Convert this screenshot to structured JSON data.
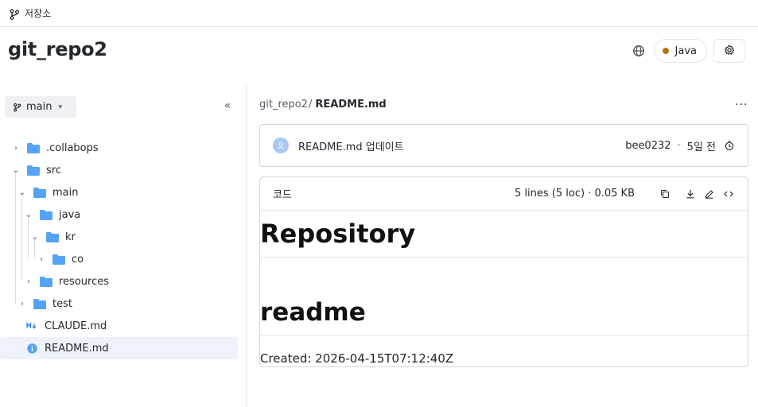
{
  "topbar": {
    "label": "저장소"
  },
  "repo": {
    "title": "git_repo2",
    "language": "Java",
    "language_color": "#b07219"
  },
  "sidebar": {
    "branch": "main",
    "collapse_glyph": "«",
    "tree": [
      {
        "name": ".collabops",
        "type": "folder",
        "expanded": false
      },
      {
        "name": "src",
        "type": "folder",
        "expanded": true
      },
      {
        "name": "main",
        "type": "folder",
        "expanded": true
      },
      {
        "name": "java",
        "type": "folder",
        "expanded": true
      },
      {
        "name": "kr",
        "type": "folder",
        "expanded": true
      },
      {
        "name": "co",
        "type": "folder",
        "expanded": false
      },
      {
        "name": "resources",
        "type": "folder",
        "expanded": false
      },
      {
        "name": "test",
        "type": "folder",
        "expanded": false
      },
      {
        "name": "CLAUDE.md",
        "type": "markdown-file"
      },
      {
        "name": "README.md",
        "type": "info-file",
        "selected": true
      }
    ]
  },
  "breadcrumb": {
    "repo": "git_repo2",
    "separator": "/",
    "file": "README.md"
  },
  "more_label": "···",
  "commit": {
    "message": "README.md 업데이트",
    "author": "bee0232",
    "separator": "·",
    "time": "5일 전"
  },
  "file": {
    "tab_label": "코드",
    "meta": "5 lines (5 loc) · 0.05 KB",
    "content": {
      "heading1": "Repository",
      "heading2": "readme",
      "paragraph": "Created: 2026-04-15T07:12:40Z"
    }
  },
  "colors": {
    "folder": "#54a3f5",
    "accent": "#2f81f7",
    "selected_row": "#eef2fd"
  }
}
